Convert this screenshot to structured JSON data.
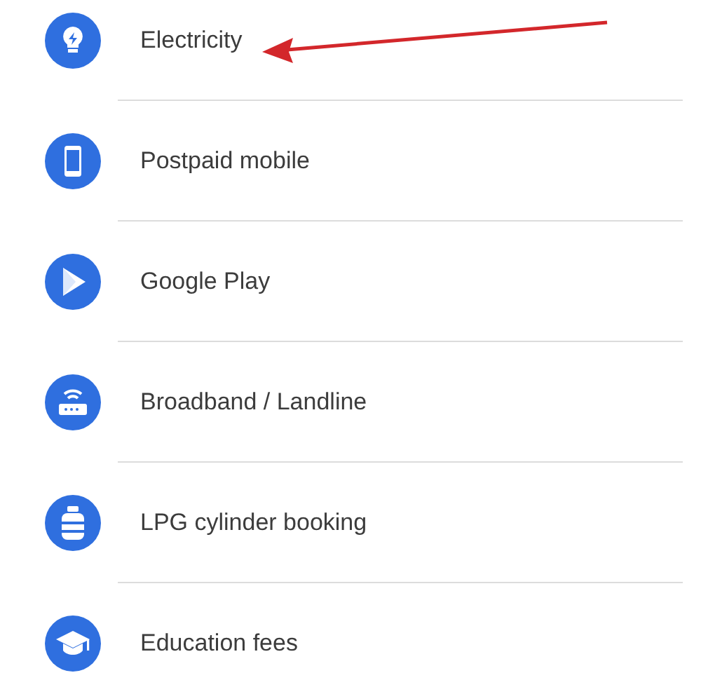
{
  "billers": [
    {
      "kind": "electricity",
      "label": "Electricity"
    },
    {
      "kind": "mobile",
      "label": "Postpaid mobile"
    },
    {
      "kind": "play",
      "label": "Google Play"
    },
    {
      "kind": "broadband",
      "label": "Broadband / Landline"
    },
    {
      "kind": "gas",
      "label": "LPG cylinder booking"
    },
    {
      "kind": "education",
      "label": "Education fees"
    }
  ]
}
